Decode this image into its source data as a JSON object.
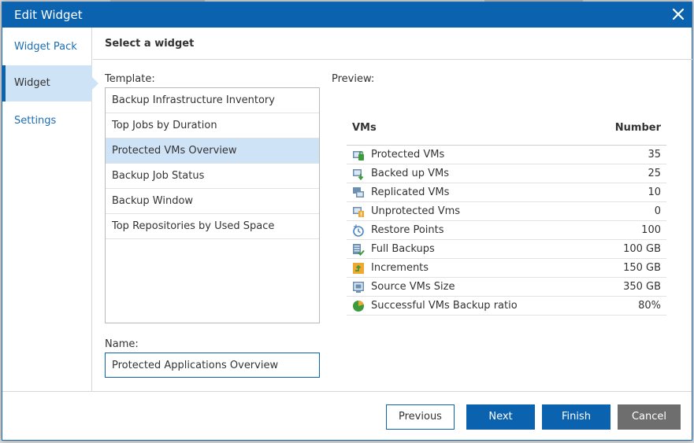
{
  "dialog": {
    "title": "Edit Widget",
    "close_icon": "close-icon"
  },
  "nav": {
    "items": [
      {
        "label": "Widget Pack"
      },
      {
        "label": "Widget"
      },
      {
        "label": "Settings"
      }
    ],
    "active": "Widget"
  },
  "section": {
    "title": "Select a widget"
  },
  "template": {
    "label": "Template:",
    "items": [
      {
        "label": "Backup Infrastructure Inventory"
      },
      {
        "label": "Top Jobs by Duration"
      },
      {
        "label": "Protected VMs Overview"
      },
      {
        "label": "Backup Job Status"
      },
      {
        "label": "Backup Window"
      },
      {
        "label": "Top Repositories by Used Space"
      }
    ],
    "selected": "Protected VMs Overview"
  },
  "name": {
    "label": "Name:",
    "value": "Protected Applications Overview"
  },
  "preview": {
    "label": "Preview:",
    "col_name": "VMs",
    "col_value": "Number",
    "rows": [
      {
        "icon": "protected-vm-icon",
        "name": "Protected VMs",
        "value": "35"
      },
      {
        "icon": "backed-up-vm-icon",
        "name": "Backed up VMs",
        "value": "25"
      },
      {
        "icon": "replicated-vm-icon",
        "name": "Replicated VMs",
        "value": "10"
      },
      {
        "icon": "unprotected-vm-icon",
        "name": "Unprotected Vms",
        "value": "0"
      },
      {
        "icon": "restore-point-icon",
        "name": "Restore Points",
        "value": "100"
      },
      {
        "icon": "full-backup-icon",
        "name": "Full Backups",
        "value": "100 GB"
      },
      {
        "icon": "increment-icon",
        "name": "Increments",
        "value": "150 GB"
      },
      {
        "icon": "source-vm-size-icon",
        "name": "Source VMs Size",
        "value": "350 GB"
      },
      {
        "icon": "pie-chart-icon",
        "name": "Successful VMs Backup ratio",
        "value": "80%"
      }
    ]
  },
  "footer": {
    "previous": "Previous",
    "next": "Next",
    "finish": "Finish",
    "cancel": "Cancel"
  },
  "colors": {
    "accent": "#0b63b0",
    "selection": "#cfe3f7",
    "cancel": "#6e6e6e",
    "link": "#1a6fb5"
  }
}
